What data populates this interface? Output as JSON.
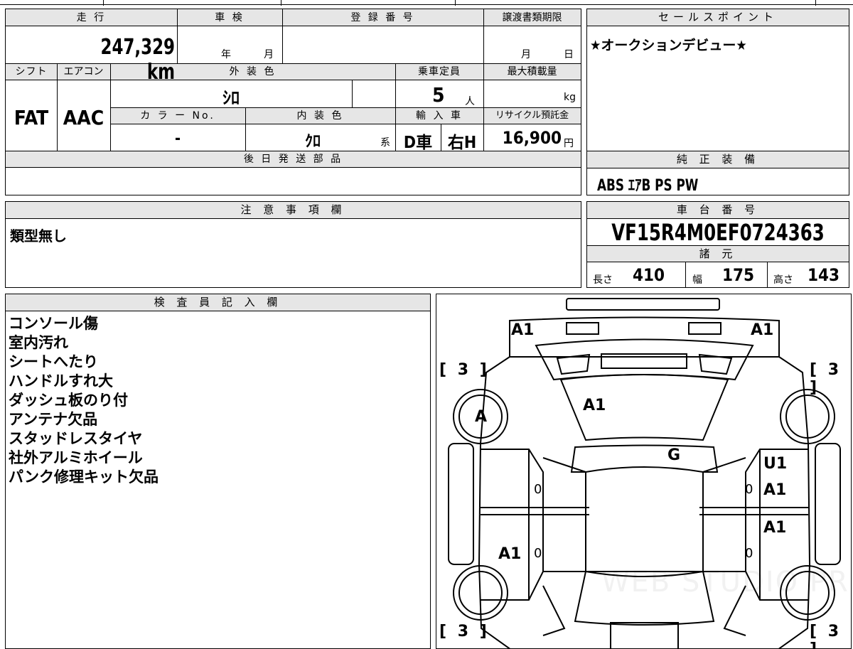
{
  "vehicle": {
    "mileage_label": "走 行",
    "mileage_value": "247,329 km",
    "inspection_label": "車 検",
    "inspection_year_unit": "年",
    "inspection_month_unit": "月",
    "registration_label": "登 録 番 号",
    "transfer_label": "譲渡書類期限",
    "transfer_month_unit": "月",
    "transfer_day_unit": "日",
    "shift_label": "シフト",
    "shift_value": "FAT",
    "aircon_label": "エアコン",
    "aircon_value": "AAC",
    "exterior_color_label": "外 装 色",
    "exterior_color_value": "ｼﾛ",
    "capacity_label": "乗車定員",
    "capacity_value": "5",
    "capacity_unit": "人",
    "max_load_label": "最大積載量",
    "max_load_unit": "kg",
    "color_no_label": "カ ラ ー No.",
    "color_no_value": "-",
    "interior_color_label": "内 装 色",
    "interior_color_value": "ｸﾛ",
    "interior_color_unit": "系",
    "import_label": "輸 入 車",
    "import_dealer_value": "D車",
    "import_handle_value": "右H",
    "recycle_label": "リサイクル預託金",
    "recycle_value": "16,900",
    "recycle_unit": "円",
    "later_parts_label": "後 日 発 送 部 品"
  },
  "sales_point": {
    "label": "セールスポイント",
    "text": "★オークションデビュー★"
  },
  "equipment": {
    "label": "純 正 装 備",
    "text": "ABS ｴｱB PS PW"
  },
  "caution": {
    "label": "注 意 事 項 欄",
    "text": "類型無し"
  },
  "chassis": {
    "label": "車 台 番 号",
    "number": "VF15R4M0EF0724363",
    "spec_label": "諸 元",
    "length_label": "長さ",
    "length_value": "410",
    "width_label": "幅",
    "width_value": "175",
    "height_label": "高さ",
    "height_value": "143"
  },
  "inspector": {
    "label": "検 査 員 記 入 欄",
    "notes": [
      "コンソール傷",
      "室内汚れ",
      "シートへたり",
      "ハンドルすれ大",
      "ダッシュ板のり付",
      "アンテナ欠品",
      "スタッドレスタイヤ",
      "社外アルミホイール",
      "パンク修理キット欠品"
    ]
  },
  "diagram": {
    "tire_front_left": "3",
    "tire_front_right": "3",
    "tire_rear_left": "3",
    "tire_rear_right": "3",
    "wheel_front_left": "A",
    "lamp_front_left": "A1",
    "lamp_front_right": "A1",
    "hood": "A1",
    "windshield": "G",
    "door_right_front_1": "U1",
    "door_right_front_2": "A1",
    "door_right_rear": "A1",
    "door_left_rear": "A1",
    "zero_1": "0",
    "zero_2": "0",
    "zero_3": "0",
    "zero_4": "0",
    "watermark": "WEB STUDIO PRO"
  }
}
